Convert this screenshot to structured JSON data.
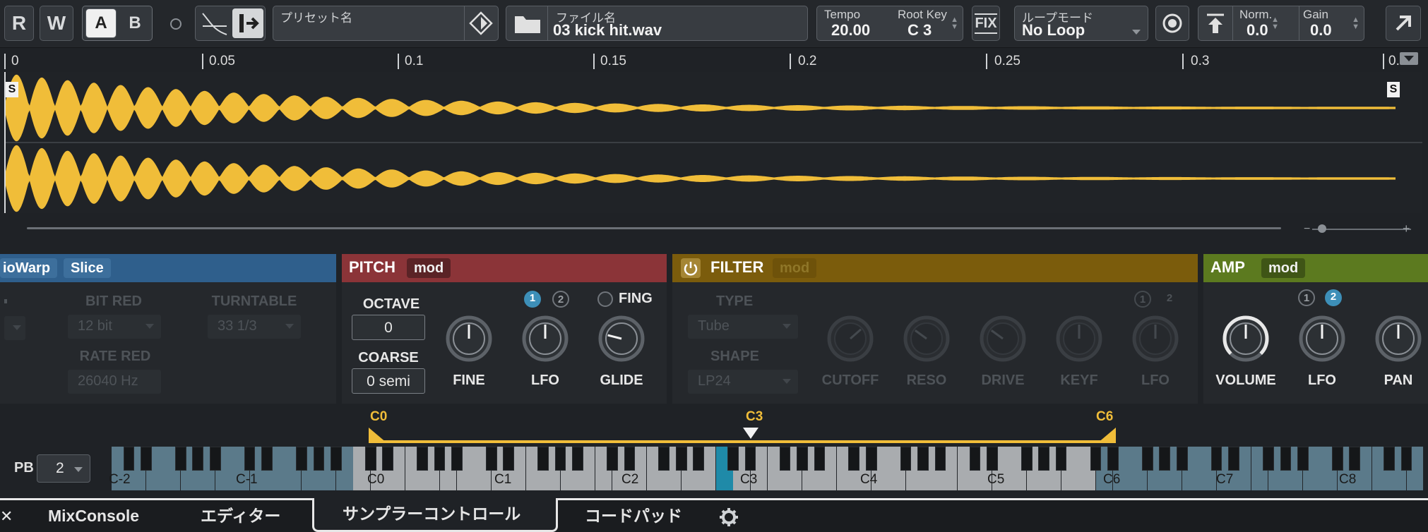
{
  "toolbar": {
    "r_label": "R",
    "w_label": "W",
    "a_label": "A",
    "b_label": "B",
    "preset_label": "プリセット名",
    "file_label": "ファイル名",
    "file_name": "03 kick hit.wav",
    "tempo_label": "Tempo",
    "tempo_value": "20.00",
    "rootkey_label": "Root Key",
    "rootkey_value": "C 3",
    "fix_label": "FIX",
    "loopmode_label": "ループモード",
    "loopmode_value": "No Loop",
    "norm_label": "Norm.",
    "norm_value": "0.0",
    "gain_label": "Gain",
    "gain_value": "0.0"
  },
  "ruler": {
    "labels": [
      "0",
      "0.05",
      "0.1",
      "0.15",
      "0.2",
      "0.25",
      "0.3",
      "0."
    ]
  },
  "waveform": {
    "color": "#f0bd39",
    "start_marker": "S",
    "end_marker": "S"
  },
  "audiowarp": {
    "tab1": "ioWarp",
    "tab2": "Slice",
    "bitred_label": "BIT RED",
    "bitred_value": "12 bit",
    "turntable_label": "TURNTABLE",
    "turntable_value": "33 1/3",
    "ratered_label": "RATE RED",
    "ratered_value": "26040 Hz",
    "color": "#2f5f8c"
  },
  "pitch": {
    "title": "PITCH",
    "mod": "mod",
    "octave_label": "OCTAVE",
    "octave_value": "0",
    "coarse_label": "COARSE",
    "coarse_value": "0 semi",
    "fine_label": "FINE",
    "lfo_label": "LFO",
    "lfo1": "1",
    "lfo2": "2",
    "glide_label": "GLIDE",
    "fing_label": "FING",
    "color": "#8b3438"
  },
  "filter": {
    "title": "FILTER",
    "mod": "mod",
    "type_label": "TYPE",
    "type_value": "Tube",
    "shape_label": "SHAPE",
    "shape_value": "LP24",
    "cutoff_label": "CUTOFF",
    "reso_label": "RESO",
    "drive_label": "DRIVE",
    "keyf_label": "KEYF",
    "lfo_label": "LFO",
    "lfo1": "1",
    "lfo2": "2",
    "color": "#7b5c0c"
  },
  "amp": {
    "title": "AMP",
    "mod": "mod",
    "volume_label": "VOLUME",
    "lfo_label": "LFO",
    "pan_label": "PAN",
    "lfo1": "1",
    "lfo2": "2",
    "color": "#5c7a1f"
  },
  "keyboard": {
    "pb_label": "PB",
    "pb_value": "2",
    "range_low": "C0",
    "root": "C3",
    "range_high": "C6",
    "octave_labels": [
      "C-2",
      "C-1",
      "C0",
      "C1",
      "C2",
      "C3",
      "C4",
      "C5",
      "C6",
      "C7",
      "C8"
    ]
  },
  "tabs": {
    "close": "✕",
    "mixconsole": "MixConsole",
    "editor": "エディター",
    "sampler": "サンプラーコントロール",
    "chordpad": "コードパッド"
  }
}
